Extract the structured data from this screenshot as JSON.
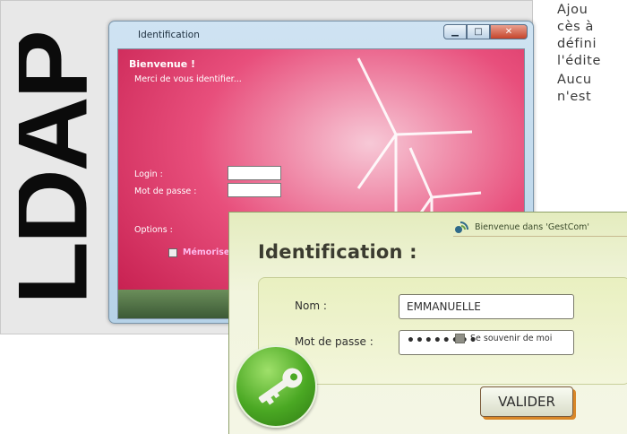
{
  "article": {
    "lines": [
      "Ajou",
      "cès à",
      "défini",
      "l'édite",
      "Aucu",
      "n'est"
    ]
  },
  "ldap_panel": {
    "logo_text": "LDAP"
  },
  "vista_dialog": {
    "title": "Identification",
    "welcome": "Bienvenue !",
    "subtitle": "Merci de vous identifier...",
    "login_label": "Login :",
    "password_label": "Mot de passe :",
    "options_label": "Options :",
    "remember_label": "Mémorise"
  },
  "gestcom_dialog": {
    "banner": "Bienvenue dans 'GestCom'",
    "heading": "Identification :",
    "name_label": "Nom :",
    "name_value": "EMMANUELLE",
    "password_label": "Mot de passe :",
    "password_value": "••••••••",
    "remember_label": "Se souvenir de moi",
    "submit_label": "VALIDER"
  },
  "colors": {
    "vista_background": "#e84f7c",
    "gestcom_background": "#eef2d4",
    "key_button": "#4aa823",
    "submit_shadow": "#d98728"
  }
}
